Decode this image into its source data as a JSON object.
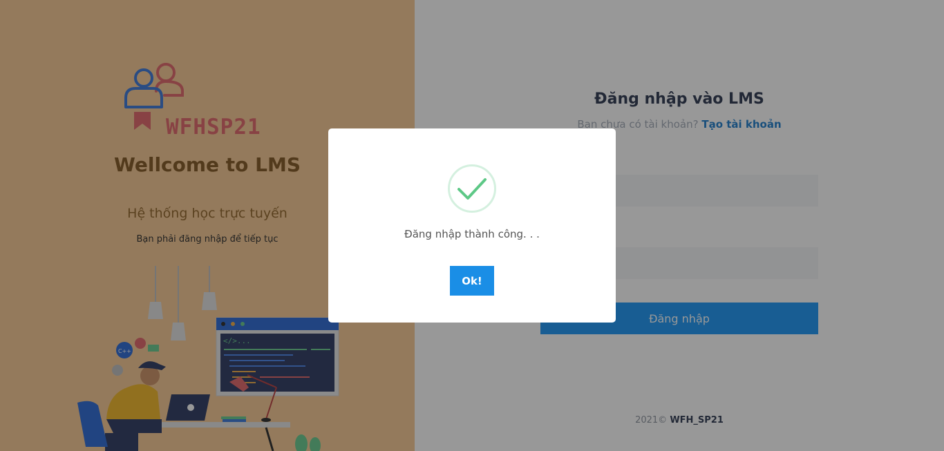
{
  "brand": {
    "logo_text": "WFHSP21",
    "welcome": "Wellcome to LMS",
    "subtitle": "Hệ thống học trực tuyến",
    "hint": "Bạn phải đăng nhập để tiếp tục"
  },
  "illustration": {
    "code_tag": "</>..."
  },
  "form": {
    "title": "Đăng nhập vào LMS",
    "no_account": "Bạn chưa có tài khoản?",
    "create_account": "Tạo tài khoản",
    "username_value": "",
    "password_value": "",
    "login_button": "Đăng nhập"
  },
  "footer": {
    "year": "2021©",
    "brand": "WFH_SP21"
  },
  "modal": {
    "message": "Đăng nhập thành công. . .",
    "ok_button": "Ok!"
  },
  "colors": {
    "left_bg": "#f7c68c",
    "accent": "#0a8ef5",
    "success": "#5dc886",
    "logo_red": "#e05a5f",
    "logo_blue": "#2d6ed6"
  }
}
